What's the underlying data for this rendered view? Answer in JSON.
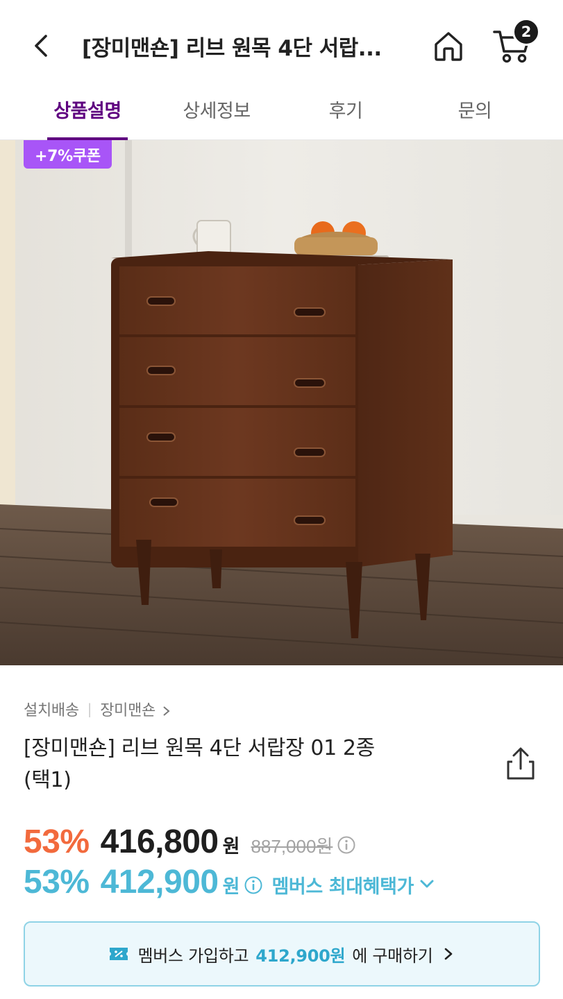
{
  "header": {
    "title": "[장미맨숀] 리브 원목 4단 서랍...",
    "cart_count": "2",
    "back_icon": "back-arrow-icon",
    "home_icon": "home-icon",
    "cart_icon": "cart-icon"
  },
  "tabs": [
    {
      "label": "상품설명",
      "active": true
    },
    {
      "label": "상세정보",
      "active": false
    },
    {
      "label": "후기",
      "active": false
    },
    {
      "label": "문의",
      "active": false
    }
  ],
  "image": {
    "coupon_badge": "+7%쿠폰"
  },
  "product": {
    "delivery_type": "설치배송",
    "brand": "장미맨숀",
    "name_line1": "[장미맨숀] 리브 원목 4단 서랍장 01 2종",
    "name_line2": "(택1)"
  },
  "pricing": {
    "discount_rate": "53%",
    "price": "416,800",
    "currency": "원",
    "original_price": "887,000원",
    "member_discount_rate": "53%",
    "member_price": "412,900",
    "member_label": "멤버스 최대혜택가"
  },
  "cta": {
    "prefix": "멤버스 가입하고",
    "price": "412,900원",
    "suffix": "에 구매하기"
  },
  "colors": {
    "brand_purple": "#5f0080",
    "coupon_purple": "#a855f7",
    "discount_orange": "#f26a3d",
    "member_blue": "#4db8d6",
    "cta_bg": "#ecf8fc",
    "cta_border": "#8fd3e6"
  }
}
